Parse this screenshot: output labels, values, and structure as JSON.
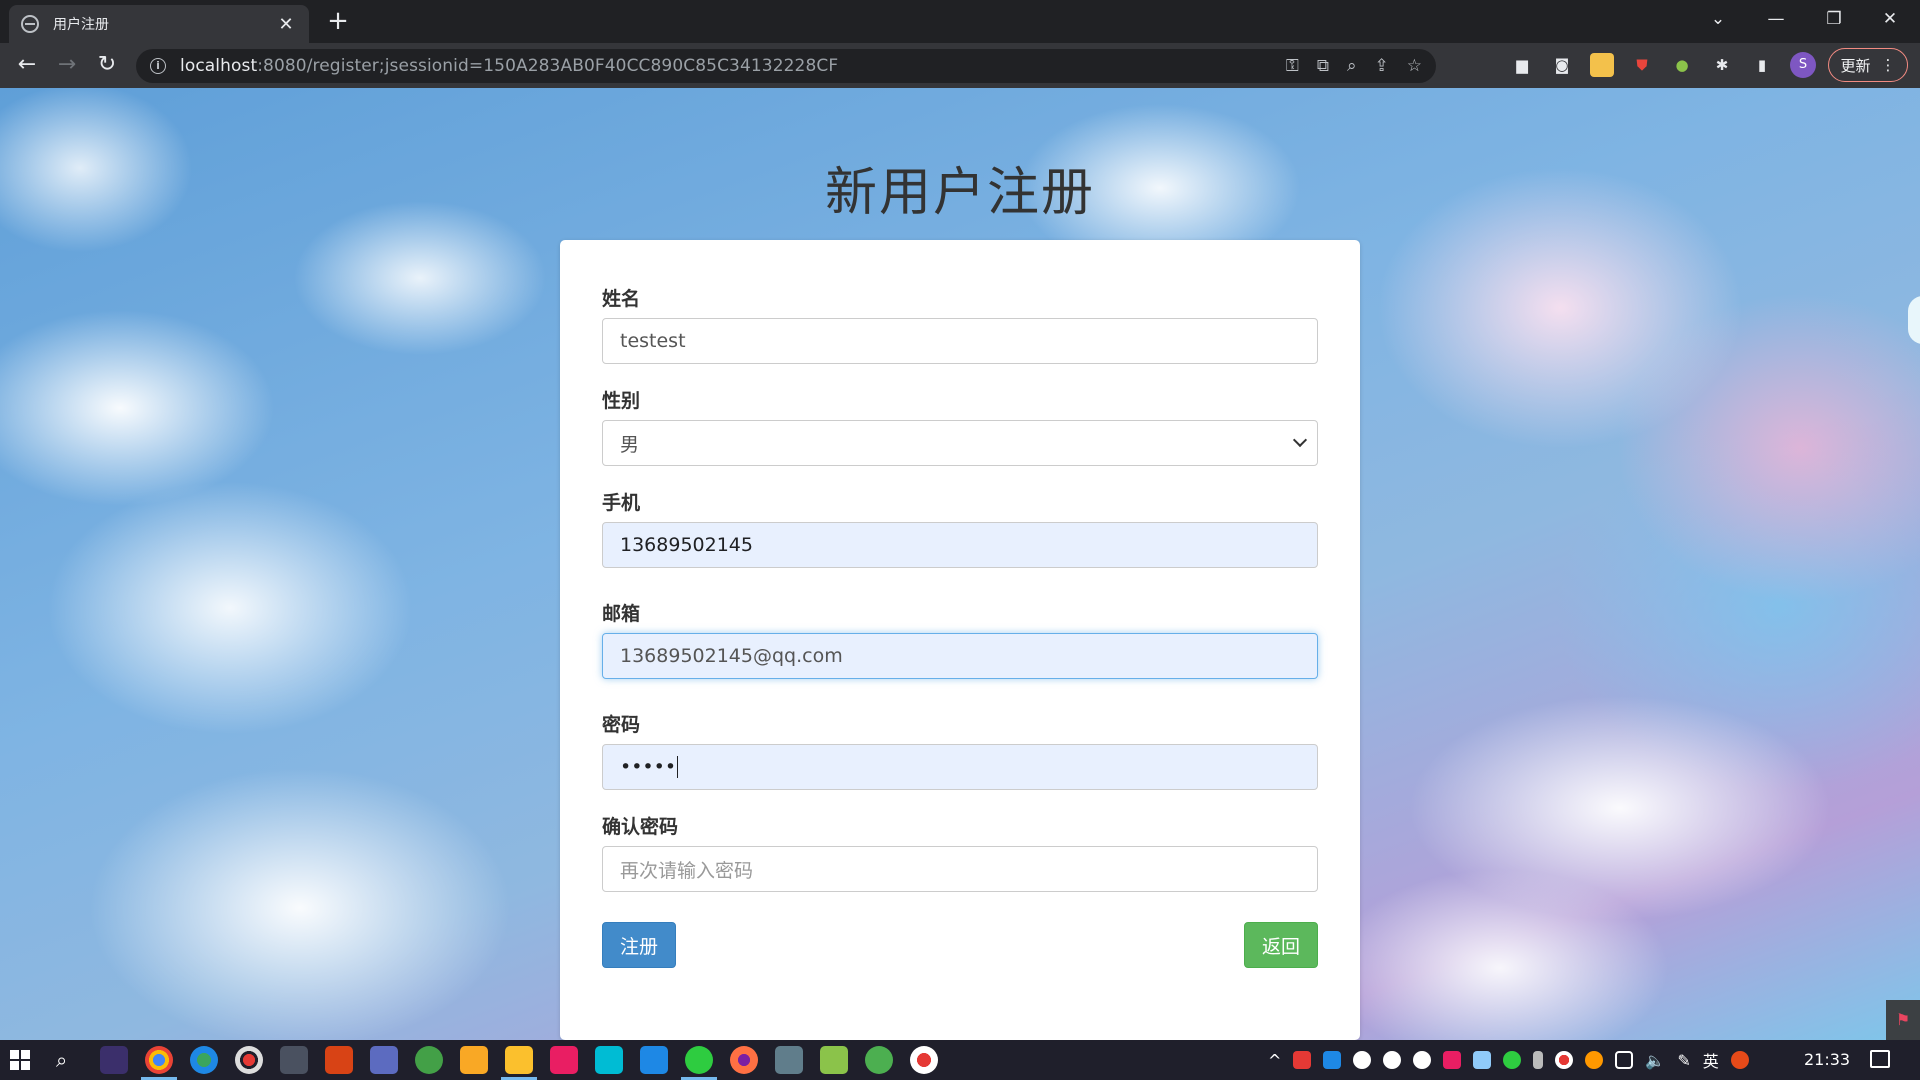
{
  "browser": {
    "tab_title": "用户注册",
    "url_host": "localhost",
    "url_rest": ":8080/register;jsessionid=150A283AB0F40CC890C85C34132228CF",
    "update_label": "更新",
    "profile_initial": "S"
  },
  "page": {
    "title": "新用户注册",
    "fields": {
      "name": {
        "label": "姓名",
        "value": "testest"
      },
      "gender": {
        "label": "性别",
        "value": "男"
      },
      "phone": {
        "label": "手机",
        "value": "13689502145"
      },
      "email": {
        "label": "邮箱",
        "value": "13689502145@qq.com"
      },
      "password": {
        "label": "密码",
        "value": "•••••"
      },
      "confirm": {
        "label": "确认密码",
        "placeholder": "再次请输入密码"
      }
    },
    "buttons": {
      "register": "注册",
      "back": "返回"
    }
  },
  "taskbar": {
    "ime": "英",
    "time": "21:33"
  },
  "colors": {
    "primary": "#428bca",
    "success": "#5cb85c",
    "autofill": "#e8f0fe",
    "focus_border": "#66afe9"
  }
}
